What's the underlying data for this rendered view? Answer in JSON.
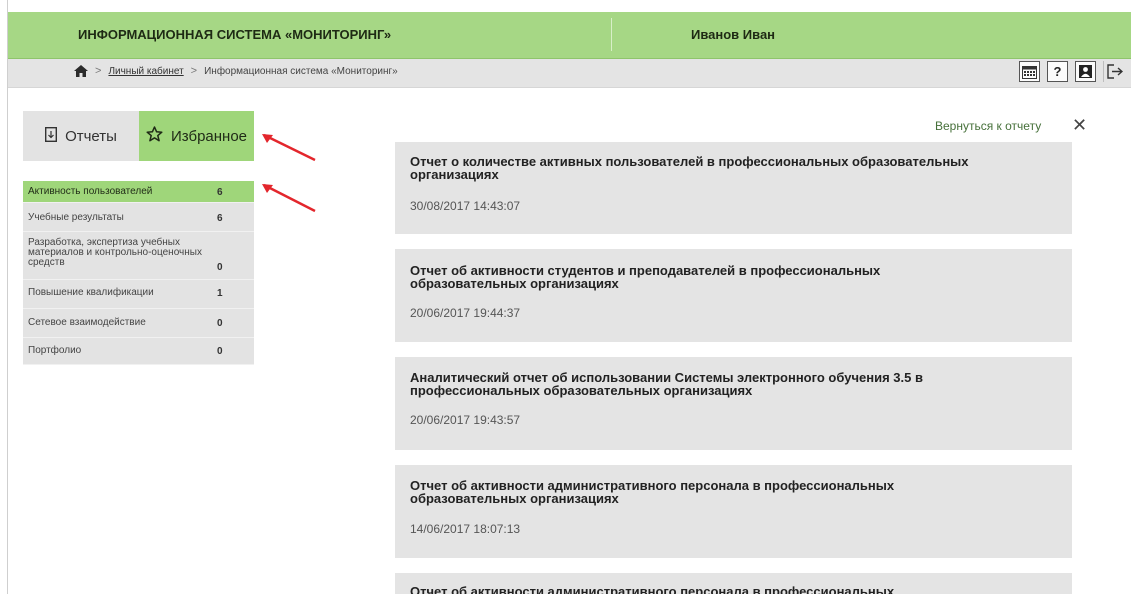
{
  "header": {
    "title": "ИНФОРМАЦИОННАЯ СИСТЕМА «МОНИТОРИНГ»",
    "user": "Иванов Иван"
  },
  "breadcrumb": {
    "home_icon": "home-icon",
    "items": [
      "Личный кабинет",
      "Информационная система «Мониторинг»"
    ],
    "separator": ">"
  },
  "toolbar": {
    "icons": [
      "calendar-icon",
      "help-icon",
      "profile-icon",
      "logout-icon"
    ],
    "help_glyph": "?"
  },
  "tabs": [
    {
      "label": "Отчеты",
      "icon": "report-icon",
      "active": false
    },
    {
      "label": "Избранное",
      "icon": "star-icon",
      "active": true
    }
  ],
  "categories": [
    {
      "label": "Активность пользователей",
      "count": "6",
      "active": true
    },
    {
      "label": "Учебные результаты",
      "count": "6"
    },
    {
      "label": "Разработка, экспертиза учебных материалов и контрольно-оценочных средств",
      "count": "0"
    },
    {
      "label": "Повышение квалификации",
      "count": "1"
    },
    {
      "label": "Сетевое взаимодействие",
      "count": "0"
    },
    {
      "label": "Портфолио",
      "count": "0"
    }
  ],
  "main": {
    "back_link": "Вернуться к отчету",
    "close": "✕",
    "reports": [
      {
        "title": "Отчет о количестве активных пользователей в профессиональных образовательных организациях",
        "date": "30/08/2017 14:43:07"
      },
      {
        "title": "Отчет об активности студентов и преподавателей в профессиональных образовательных организациях",
        "date": "20/06/2017 19:44:37"
      },
      {
        "title": "Аналитический отчет об использовании Системы электронного обучения 3.5 в профессиональных образовательных организациях",
        "date": "20/06/2017 19:43:57"
      },
      {
        "title": "Отчет об активности административного персонала в профессиональных образовательных организациях",
        "date": "14/06/2017 18:07:13"
      },
      {
        "title": "Отчет об активности административного персонала в профессиональных",
        "date": ""
      }
    ]
  },
  "colors": {
    "header_green": "#a6d785",
    "active_green": "#9fd67a",
    "panel_gray": "#e4e4e4",
    "arrow_red": "#e3262c",
    "link_green": "#46703a"
  }
}
